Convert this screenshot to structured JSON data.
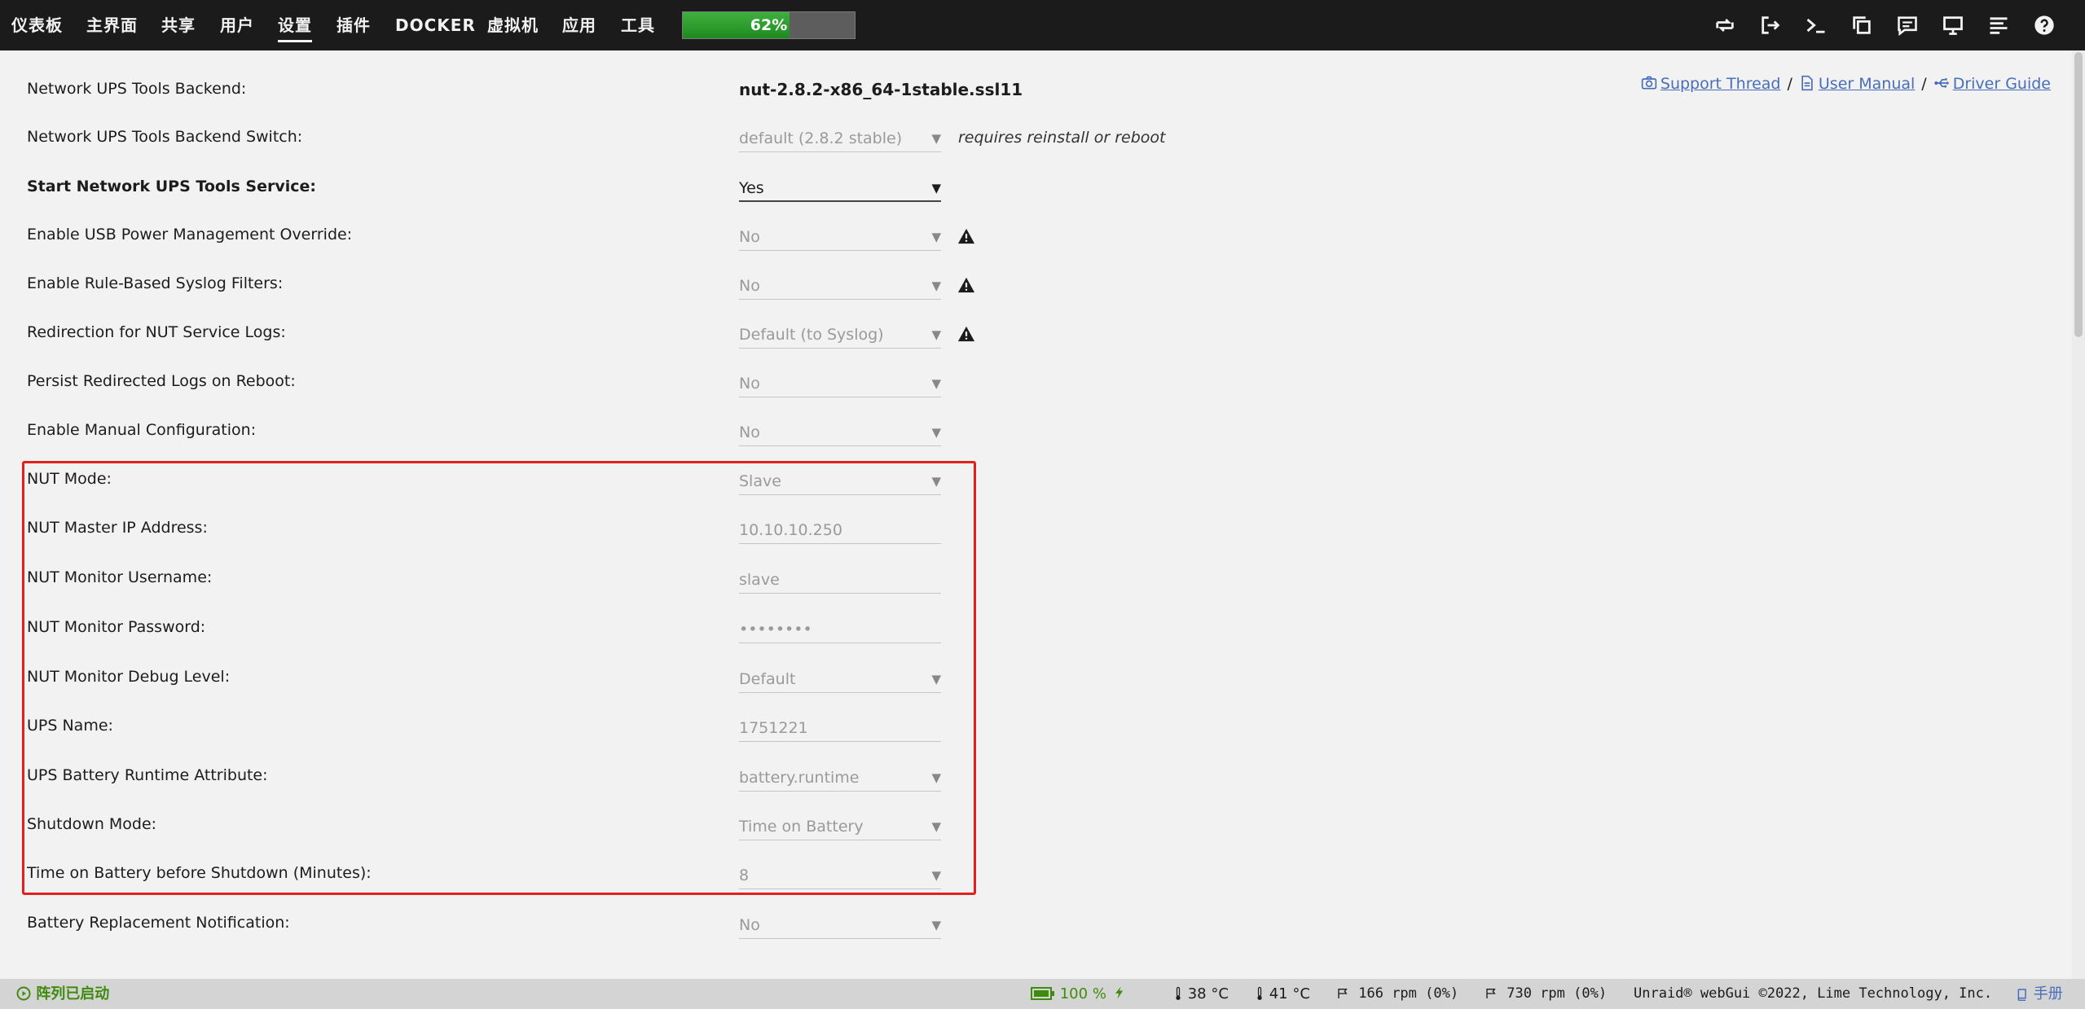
{
  "nav": {
    "items": [
      "仪表板",
      "主界面",
      "共享",
      "用户",
      "设置",
      "插件",
      "DOCKER",
      "虚拟机",
      "应用",
      "工具"
    ],
    "active": "设置",
    "cpu_percent": 62,
    "cpu_label": "62%",
    "icons": [
      "switch-icon",
      "logout-icon",
      "terminal-icon",
      "copy-icon",
      "feedback-icon",
      "monitor-icon",
      "log-icon",
      "help-icon"
    ]
  },
  "help_links": {
    "support": "Support Thread",
    "manual": "User Manual",
    "driver": "Driver Guide",
    "separator": "/"
  },
  "settings": {
    "backend_label": "Network UPS Tools Backend:",
    "backend_value": "nut-2.8.2-x86_64-1stable.ssl11",
    "backend_switch_label": "Network UPS Tools Backend Switch:",
    "backend_switch_value": "default (2.8.2 stable)",
    "backend_switch_note": "requires reinstall or reboot",
    "start_service_label": "Start Network UPS Tools Service:",
    "start_service_value": "Yes",
    "usb_override_label": "Enable USB Power Management Override:",
    "usb_override_value": "No",
    "syslog_filters_label": "Enable Rule-Based Syslog Filters:",
    "syslog_filters_value": "No",
    "log_redirect_label": "Redirection for NUT Service Logs:",
    "log_redirect_value": "Default (to Syslog)",
    "persist_logs_label": "Persist Redirected Logs on Reboot:",
    "persist_logs_value": "No",
    "manual_config_label": "Enable Manual Configuration:",
    "manual_config_value": "No",
    "nut_mode_label": "NUT Mode:",
    "nut_mode_value": "Slave",
    "master_ip_label": "NUT Master IP Address:",
    "master_ip_value": "10.10.10.250",
    "monitor_user_label": "NUT Monitor Username:",
    "monitor_user_value": "slave",
    "monitor_pass_label": "NUT Monitor Password:",
    "monitor_pass_value": "••••••••",
    "debug_level_label": "NUT Monitor Debug Level:",
    "debug_level_value": "Default",
    "ups_name_label": "UPS Name:",
    "ups_name_value": "1751221",
    "runtime_attr_label": "UPS Battery Runtime Attribute:",
    "runtime_attr_value": "battery.runtime",
    "shutdown_mode_label": "Shutdown Mode:",
    "shutdown_mode_value": "Time on Battery",
    "time_on_battery_label": "Time on Battery before Shutdown (Minutes):",
    "time_on_battery_value": "8",
    "battery_replace_label": "Battery Replacement Notification:",
    "battery_replace_value": "No"
  },
  "footer": {
    "array_status": "阵列已启动",
    "battery": "100 %",
    "cpu_temp": "38 °C",
    "mb_temp": "41 °C",
    "fan1": "166 rpm (0%)",
    "fan2": "730 rpm (0%)",
    "copyright": "Unraid® webGui ©2022, Lime Technology, Inc.",
    "manual": "手册"
  },
  "colors": {
    "accent_link": "#486dba",
    "highlight_box": "#e0201e",
    "array_ok": "#3f8b0e",
    "topbar": "#1c1b1b"
  }
}
